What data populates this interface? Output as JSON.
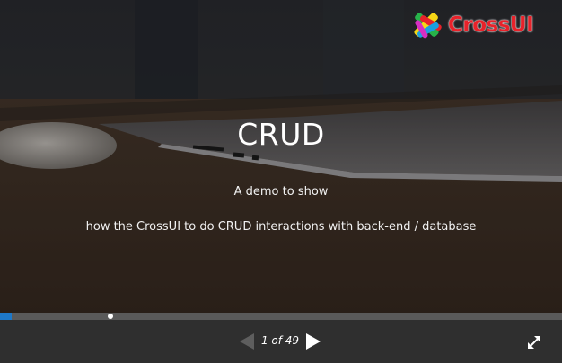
{
  "slide": {
    "title": "CRUD",
    "subtitle": "A demo to show",
    "description": "how the CrossUI to do CRUD interactions with back-end / database"
  },
  "logo": {
    "text": "CrossUI",
    "text_color": "#e8222a"
  },
  "player": {
    "counter_text": "1 of 49",
    "current_slide": 1,
    "total_slides": 49,
    "progress_fraction": 0.02,
    "accent_color": "#1e78c8",
    "icons": {
      "previous": "triangle-left-icon",
      "next": "triangle-right-icon",
      "fullscreen": "expand-arrows-icon"
    }
  }
}
